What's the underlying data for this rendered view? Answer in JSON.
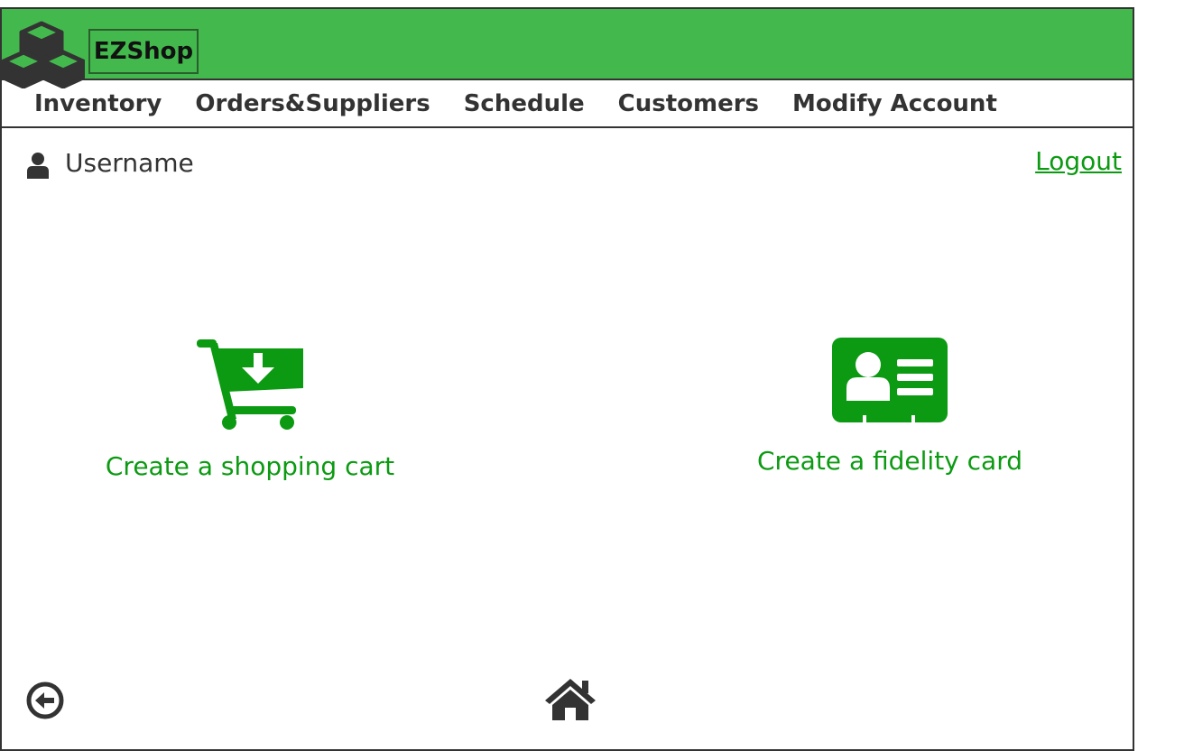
{
  "header": {
    "brand": "EZShop",
    "logo_icon": "cubes-icon",
    "color": "#43b84c"
  },
  "nav": {
    "items": [
      {
        "label": "Inventory"
      },
      {
        "label": "Orders&Suppliers"
      },
      {
        "label": "Schedule"
      },
      {
        "label": "Customers"
      },
      {
        "label": "Modify Account"
      }
    ]
  },
  "user": {
    "icon": "user-icon",
    "name": "Username"
  },
  "logout_label": "Logout",
  "actions": [
    {
      "icon": "cart-download-icon",
      "label": "Create a shopping cart"
    },
    {
      "icon": "id-card-icon",
      "label": "Create a fidelity card"
    }
  ],
  "footer": {
    "back_icon": "back-arrow-circle-icon",
    "home_icon": "home-icon"
  },
  "colors": {
    "accent": "#0c9a12",
    "dark": "#333333"
  }
}
